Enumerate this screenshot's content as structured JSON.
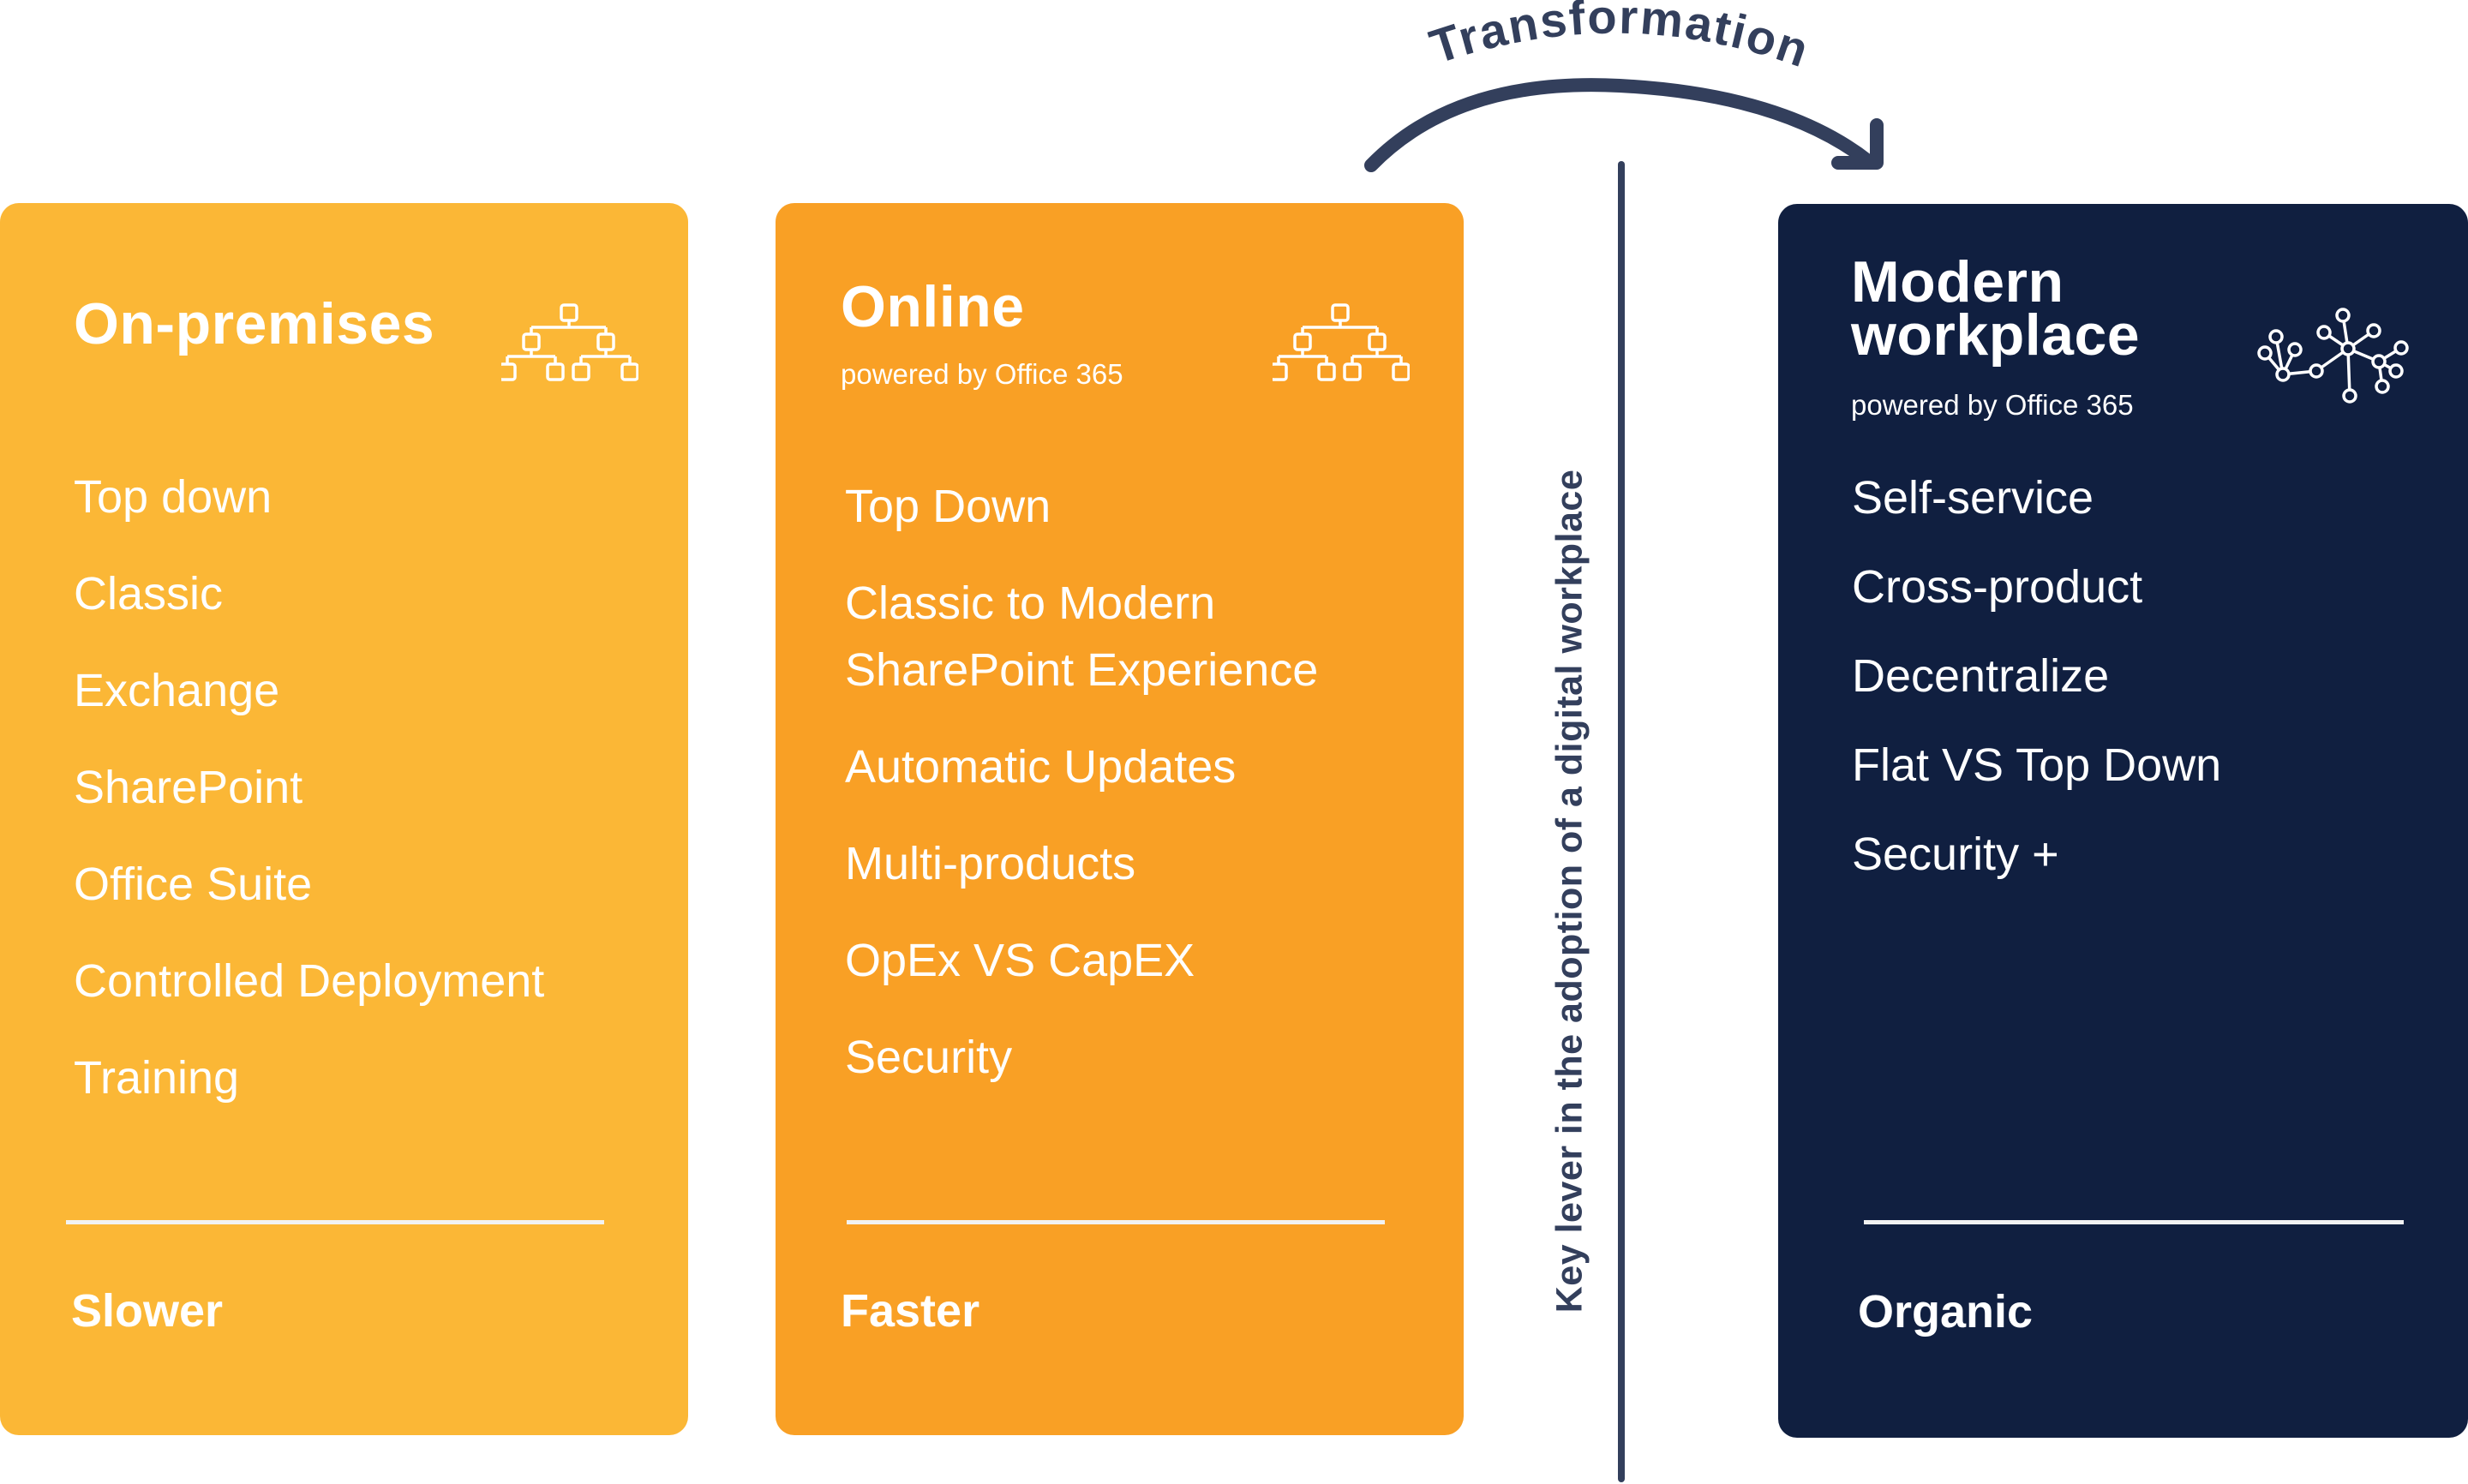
{
  "transformation_label": "Transformation",
  "key_lever_caption": "Key lever in the adoption of a digital workplace",
  "colors": {
    "on_premises": "#FBB736",
    "online": "#F9A025",
    "modern": "#101F40",
    "accent_navy": "#333F5C",
    "text": "#FFFFFF"
  },
  "cards": [
    {
      "title": "On-premises",
      "subtitle": "",
      "icon": "hierarchy-icon",
      "items": [
        "Top down",
        "Classic",
        "Exchange",
        "SharePoint",
        "Office Suite",
        "Controlled Deployment",
        "Training"
      ],
      "speed": "Slower"
    },
    {
      "title": "Online",
      "subtitle": "powered by Office 365",
      "icon": "hierarchy-icon",
      "items": [
        "Top Down",
        "Classic to Modern SharePoint Experience",
        "Automatic Updates",
        "Multi-products",
        "OpEx VS CapEX",
        "Security"
      ],
      "speed": "Faster"
    },
    {
      "title_line1": "Modern",
      "title_line2": "workplace",
      "subtitle": "powered by Office 365",
      "icon": "network-icon",
      "items": [
        "Self-service",
        "Cross-product",
        "Decentralize",
        "Flat VS Top Down",
        "Security +"
      ],
      "speed": "Organic"
    }
  ]
}
